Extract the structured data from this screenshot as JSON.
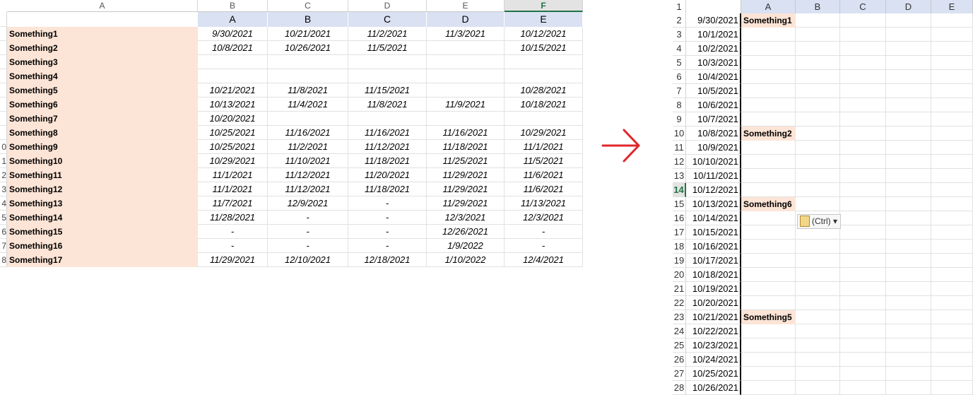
{
  "left_sheet": {
    "column_headers": [
      "A",
      "B",
      "C",
      "D",
      "E",
      "F"
    ],
    "active_column": "F",
    "subheaders": [
      "A",
      "B",
      "C",
      "D",
      "E"
    ],
    "row_numbers": [
      "",
      "",
      "",
      "",
      "",
      "",
      "",
      "",
      "",
      "0",
      "1",
      "2",
      "3",
      "4",
      "5",
      "6",
      "7",
      "8"
    ],
    "rows": [
      {
        "name": "Something1",
        "values": [
          "9/30/2021",
          "10/21/2021",
          "11/2/2021",
          "11/3/2021",
          "10/12/2021"
        ]
      },
      {
        "name": "Something2",
        "values": [
          "10/8/2021",
          "10/26/2021",
          "11/5/2021",
          "",
          "10/15/2021"
        ]
      },
      {
        "name": "Something3",
        "values": [
          "",
          "",
          "",
          "",
          ""
        ]
      },
      {
        "name": "Something4",
        "values": [
          "",
          "",
          "",
          "",
          ""
        ]
      },
      {
        "name": "Something5",
        "values": [
          "10/21/2021",
          "11/8/2021",
          "11/15/2021",
          "",
          "10/28/2021"
        ]
      },
      {
        "name": "Something6",
        "values": [
          "10/13/2021",
          "11/4/2021",
          "11/8/2021",
          "11/9/2021",
          "10/18/2021"
        ]
      },
      {
        "name": "Something7",
        "values": [
          "10/20/2021",
          "",
          "",
          "",
          ""
        ]
      },
      {
        "name": "Something8",
        "values": [
          "10/25/2021",
          "11/16/2021",
          "11/16/2021",
          "11/16/2021",
          "10/29/2021"
        ]
      },
      {
        "name": "Something9",
        "values": [
          "10/25/2021",
          "11/2/2021",
          "11/12/2021",
          "11/18/2021",
          "11/1/2021"
        ]
      },
      {
        "name": "Something10",
        "values": [
          "10/29/2021",
          "11/10/2021",
          "11/18/2021",
          "11/25/2021",
          "11/5/2021"
        ]
      },
      {
        "name": "Something11",
        "values": [
          "11/1/2021",
          "11/12/2021",
          "11/20/2021",
          "11/29/2021",
          "11/6/2021"
        ]
      },
      {
        "name": "Something12",
        "values": [
          "11/1/2021",
          "11/12/2021",
          "11/18/2021",
          "11/29/2021",
          "11/6/2021"
        ]
      },
      {
        "name": "Something13",
        "values": [
          "11/7/2021",
          "12/9/2021",
          "-",
          "11/29/2021",
          "11/13/2021"
        ]
      },
      {
        "name": "Something14",
        "values": [
          "11/28/2021",
          "-",
          "-",
          "12/3/2021",
          "12/3/2021"
        ]
      },
      {
        "name": "Something15",
        "values": [
          "-",
          "-",
          "-",
          "12/26/2021",
          "-"
        ]
      },
      {
        "name": "Something16",
        "values": [
          "-",
          "-",
          "-",
          "1/9/2022",
          "-"
        ]
      },
      {
        "name": "Something17",
        "values": [
          "11/29/2021",
          "12/10/2021",
          "12/18/2021",
          "1/10/2022",
          "12/4/2021"
        ]
      }
    ]
  },
  "arrow": {
    "color": "#e0262b"
  },
  "right_sheet": {
    "column_headers": [
      "A",
      "B",
      "C",
      "D",
      "E"
    ],
    "active_row": "14",
    "rows": [
      {
        "num": "1",
        "date": "",
        "name": ""
      },
      {
        "num": "2",
        "date": "9/30/2021",
        "name": "Something1"
      },
      {
        "num": "3",
        "date": "10/1/2021",
        "name": ""
      },
      {
        "num": "4",
        "date": "10/2/2021",
        "name": ""
      },
      {
        "num": "5",
        "date": "10/3/2021",
        "name": ""
      },
      {
        "num": "6",
        "date": "10/4/2021",
        "name": ""
      },
      {
        "num": "7",
        "date": "10/5/2021",
        "name": ""
      },
      {
        "num": "8",
        "date": "10/6/2021",
        "name": ""
      },
      {
        "num": "9",
        "date": "10/7/2021",
        "name": ""
      },
      {
        "num": "10",
        "date": "10/8/2021",
        "name": "Something2"
      },
      {
        "num": "11",
        "date": "10/9/2021",
        "name": ""
      },
      {
        "num": "12",
        "date": "10/10/2021",
        "name": ""
      },
      {
        "num": "13",
        "date": "10/11/2021",
        "name": ""
      },
      {
        "num": "14",
        "date": "10/12/2021",
        "name": ""
      },
      {
        "num": "15",
        "date": "10/13/2021",
        "name": "Something6"
      },
      {
        "num": "16",
        "date": "10/14/2021",
        "name": ""
      },
      {
        "num": "17",
        "date": "10/15/2021",
        "name": ""
      },
      {
        "num": "18",
        "date": "10/16/2021",
        "name": ""
      },
      {
        "num": "19",
        "date": "10/17/2021",
        "name": ""
      },
      {
        "num": "20",
        "date": "10/18/2021",
        "name": ""
      },
      {
        "num": "21",
        "date": "10/19/2021",
        "name": ""
      },
      {
        "num": "22",
        "date": "10/20/2021",
        "name": ""
      },
      {
        "num": "23",
        "date": "10/21/2021",
        "name": "Something5"
      },
      {
        "num": "24",
        "date": "10/22/2021",
        "name": ""
      },
      {
        "num": "25",
        "date": "10/23/2021",
        "name": ""
      },
      {
        "num": "26",
        "date": "10/24/2021",
        "name": ""
      },
      {
        "num": "27",
        "date": "10/25/2021",
        "name": ""
      },
      {
        "num": "28",
        "date": "10/26/2021",
        "name": ""
      }
    ],
    "paste_options_label": "(Ctrl)"
  }
}
